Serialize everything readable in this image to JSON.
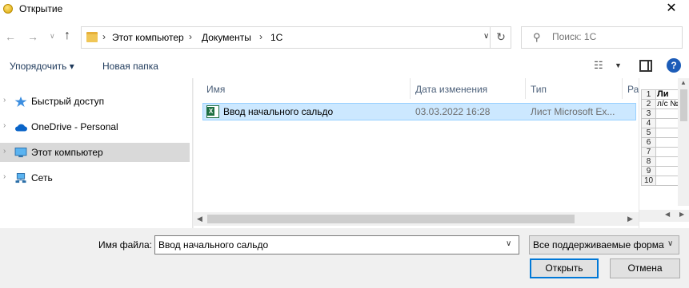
{
  "window": {
    "title": "Открытие",
    "close_glyph": "✕"
  },
  "navigation": {
    "back_icon": "arrow-left-icon",
    "forward_icon": "arrow-right-icon",
    "recent_icon": "chevron-down-icon",
    "up_icon": "arrow-up-icon",
    "breadcrumb": [
      "Этот компьютер",
      "Документы",
      "1С"
    ],
    "search_placeholder": "Поиск: 1С"
  },
  "commandbar": {
    "organize_label": "Упорядочить ▾",
    "new_folder_label": "Новая папка",
    "help_label": "?"
  },
  "nav_pane": {
    "items": [
      {
        "label": "Быстрый доступ",
        "icon": "star-icon"
      },
      {
        "label": "OneDrive - Personal",
        "icon": "cloud-icon"
      },
      {
        "label": "Этот компьютер",
        "icon": "computer-icon",
        "selected": true
      },
      {
        "label": "Сеть",
        "icon": "network-icon"
      }
    ]
  },
  "file_list": {
    "columns": [
      "Имя",
      "Дата изменения",
      "Тип",
      "Ра"
    ],
    "rows": [
      {
        "name": "Ввод начального сальдо",
        "modified": "03.03.2022 16:28",
        "type": "Лист Microsoft Ex...",
        "icon": "excel-file-icon"
      }
    ]
  },
  "preview": {
    "cells": {
      "r1": "Ли",
      "r2": "л/с №"
    },
    "row_numbers": [
      "1",
      "2",
      "3",
      "4",
      "5",
      "6",
      "7",
      "8",
      "9",
      "10"
    ]
  },
  "bottom": {
    "filename_label": "Имя файла:",
    "filename_value": "Ввод начального сальдо",
    "filter_value": "Все поддерживаемые формат",
    "open_label": "Открыть",
    "cancel_label": "Отмена"
  },
  "colors": {
    "accent": "#0078d7",
    "selection": "#cce8ff",
    "selection_border": "#99d1ff"
  }
}
